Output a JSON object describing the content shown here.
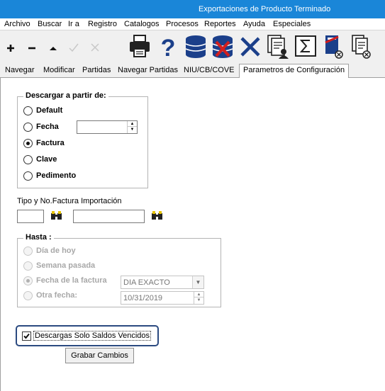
{
  "window": {
    "title": "Exportaciones de Producto Terminado"
  },
  "menu": [
    "Archivo",
    "Buscar",
    "Ir a",
    "Registro",
    "Catalogos",
    "Procesos",
    "Reportes",
    "Ayuda",
    "Especiales"
  ],
  "toolbar": {
    "icons": [
      "add-icon",
      "remove-icon",
      "arrow-up-icon",
      "approve-icon",
      "close-icon",
      "printer-icon",
      "help-icon",
      "database-icon",
      "database-delete-icon",
      "delete-x-icon",
      "documents-user-icon",
      "sum-icon",
      "document-book-icon",
      "document-copy-icon"
    ]
  },
  "tabs": [
    "Navegar",
    "Modificar",
    "Partidas",
    "Navegar Partidas",
    "NIU/CB/COVE",
    "Parametros de Configuración"
  ],
  "form": {
    "descargar": {
      "legend": "Descargar a partir de:",
      "options": [
        "Default",
        "Fecha",
        "Factura",
        "Clave",
        "Pedimento"
      ],
      "selected": "Factura",
      "fecha_value": ""
    },
    "tipo_factura": {
      "label": "Tipo y No.Factura Importación",
      "tipo_value": "",
      "numero_value": ""
    },
    "hasta": {
      "legend": "Hasta :",
      "options": [
        "Día de hoy",
        "Semana pasada",
        "Fecha de la factura",
        "Otra fecha:"
      ],
      "selected": "Fecha de la factura",
      "fecha_factura_value": "DIA EXACTO",
      "otra_fecha_value": "10/31/2019"
    },
    "checkbox": {
      "label": "Descargas Solo Saldos Vencidos",
      "checked": true
    },
    "save_button": "Grabar Cambios"
  },
  "colors": {
    "titlebar": "#1a86d8",
    "highlight_border": "#2b4a80"
  }
}
